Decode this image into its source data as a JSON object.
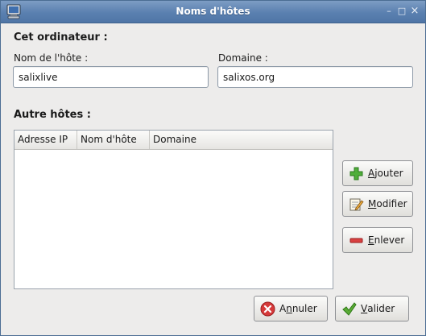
{
  "window": {
    "title": "Noms d'hôtes",
    "controls": {
      "minimize": "–",
      "maximize": "□",
      "close": "×"
    }
  },
  "computer_section": {
    "heading": "Cet ordinateur :",
    "hostname_label": "Nom de l'hôte :",
    "hostname_value": "salixlive",
    "domain_label": "Domaine :",
    "domain_value": "salixos.org"
  },
  "other_hosts_section": {
    "heading": "Autre hôtes :",
    "columns": [
      "Adresse IP",
      "Nom d'hôte",
      "Domaine"
    ],
    "rows": []
  },
  "side_buttons": {
    "add": {
      "mnemonic": "A",
      "rest": "jouter",
      "icon": "green-plus-icon"
    },
    "modify": {
      "mnemonic": "M",
      "rest": "odifier",
      "icon": "edit-notepad-icon"
    },
    "remove": {
      "mnemonic": "E",
      "rest": "nlever",
      "icon": "red-minus-icon"
    }
  },
  "dialog_buttons": {
    "cancel": {
      "pre": "A",
      "mnemonic": "n",
      "rest": "nuler",
      "icon": "cancel-x-icon"
    },
    "ok": {
      "mnemonic": "V",
      "rest": "alider",
      "icon": "checkmark-icon"
    }
  },
  "colors": {
    "titlebar": "#5a80b0",
    "add_green": "#3c9a2e",
    "remove_red": "#d23b3b",
    "cancel_red": "#cf3535",
    "ok_green": "#4c9d2d"
  }
}
